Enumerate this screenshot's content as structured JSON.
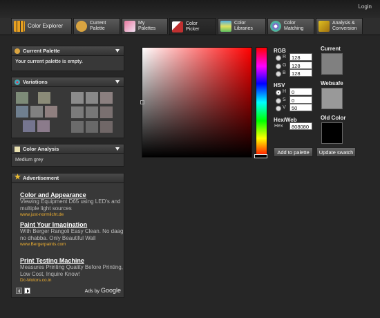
{
  "header": {
    "login_label": "Login"
  },
  "tabs": [
    {
      "label": "Color Explorer",
      "icon": "grid-icon",
      "color": "#e8a020"
    },
    {
      "label": "Current\nPalette",
      "icon": "palette-icon",
      "color": "#d9a441"
    },
    {
      "label": "My\nPalettes",
      "icon": "swatches-icon",
      "color": "#e87aa0"
    },
    {
      "label": "Color\nPicker",
      "icon": "brush-icon",
      "color": "#c03030"
    },
    {
      "label": "Color\nLibraries",
      "icon": "stack-icon",
      "color": "#50b0e0"
    },
    {
      "label": "Color\nMatching",
      "icon": "flower-icon",
      "color": "#8a5cd0"
    },
    {
      "label": "Analysis &\nConversion",
      "icon": "analysis-icon",
      "color": "#e0c020"
    }
  ],
  "sidebar": {
    "current_palette": {
      "title": "Current Palette",
      "message": "Your current palette is empty."
    },
    "variations": {
      "title": "Variations",
      "left_colors": [
        "#7d8b78",
        "#8b8b78",
        "#6f7f8f",
        "#808080",
        "#8f7f7f",
        "#75758f",
        "#8b7b8b"
      ],
      "right_colors": [
        "#8b8b8b",
        "#888888",
        "#8b7f7f",
        "#7b7b7b",
        "#777777",
        "#7a7070",
        "#6b6b6b",
        "#686868",
        "#706767"
      ]
    },
    "color_analysis": {
      "title": "Color Analysis",
      "result": "Medium grey"
    },
    "advertisement": {
      "title": "Advertisement",
      "ads": [
        {
          "title": "Color and Appearance",
          "text": "Viewing Equipment D65 using LED's and multiple light sources",
          "url": "www.just-normlicht.de"
        },
        {
          "title": "Paint Your Imagination",
          "text": "With Berger Rangoli Easy Clean. No daag no dhabba. Only Beautiful Wall",
          "url": "www.Bergerpaints.com"
        },
        {
          "title": "Print Testing Machine",
          "text": "Measures Printing Quality Before Printing, Low Cost, Inquire Know!",
          "url": "Dc-Motors.co.in"
        }
      ],
      "ads_by": "Ads by",
      "google": "Google"
    }
  },
  "picker": {
    "rgb_label": "RGB",
    "r_label": "R",
    "r_value": "128",
    "g_label": "G",
    "g_value": "128",
    "b_label": "B",
    "b_value": "128",
    "hsv_label": "HSV",
    "h_label": "H",
    "h_value": "0",
    "s_label": "S",
    "s_value": "0",
    "v_label": "V",
    "v_value": "50",
    "hex_section_label": "Hex/Web",
    "hex_label": "Hex",
    "hex_value": "808080",
    "add_button": "Add to palette",
    "update_button": "Update swatch",
    "current_label": "Current",
    "websafe_label": "Websafe",
    "old_label": "Old Color",
    "current_color": "#808080",
    "websafe_color": "#999999",
    "old_color": "#000000"
  }
}
